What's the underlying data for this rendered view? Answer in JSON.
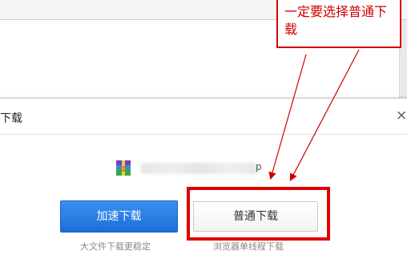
{
  "dialog": {
    "title": "下载",
    "close_symbol": "×",
    "file": {
      "icon": "archive-icon",
      "name_visible_tail": "p"
    },
    "buttons": {
      "fast_download": "加速下载",
      "normal_download": "普通下载"
    },
    "hints": {
      "fast": "大文件下载更稳定",
      "normal": "浏览器单线程下载"
    }
  },
  "annotation": {
    "callout_text": "一定要选择普通下载",
    "color": "#d00000"
  },
  "colors": {
    "primary_button": "#1a6fd8",
    "annotation": "#e00000"
  }
}
